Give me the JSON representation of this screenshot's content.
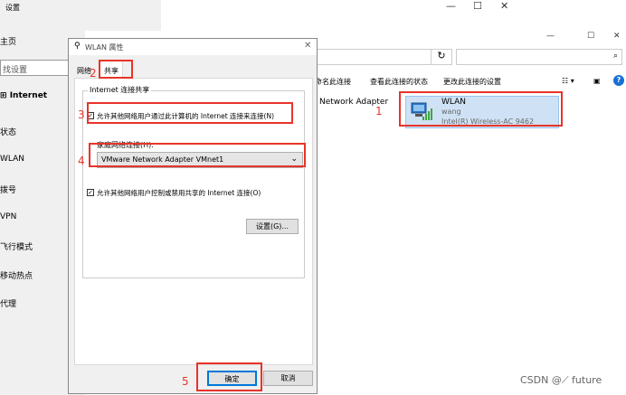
{
  "settings": {
    "title": "设置",
    "items": [
      "主页",
      "找设置",
      "Internet",
      "状态",
      "WLAN",
      "拨号",
      "VPN",
      "飞行模式",
      "移动热点",
      "代理"
    ]
  },
  "explorer": {
    "nav_chevron": "∨",
    "refresh": "↻",
    "adapter_label": "Network Adapter",
    "commands": [
      "命名此连接",
      "查看此连接的状态",
      "更改此连接的设置"
    ],
    "wlan": {
      "name": "WLAN",
      "ssid": "wang",
      "device": "Intel(R) Wireless-AC 9462"
    },
    "help": "?"
  },
  "dialog": {
    "title": "WLAN 属性",
    "tabs": [
      "网络",
      "共享"
    ],
    "group_title": "Internet 连接共享",
    "allow_connect": "允许其他网络用户通过此计算机的 Internet 连接来连接(N)",
    "home_label": "家庭网络连接(H):",
    "home_value": "VMware Network Adapter VMnet1",
    "allow_control": "允许其他网络用户控制或禁用共享的 Internet 连接(O)",
    "settings_btn": "设置(G)...",
    "ok": "确定",
    "cancel": "取消"
  },
  "annotations": [
    "1",
    "2",
    "3",
    "4",
    "5"
  ],
  "watermark": "CSDN @⟋ future"
}
